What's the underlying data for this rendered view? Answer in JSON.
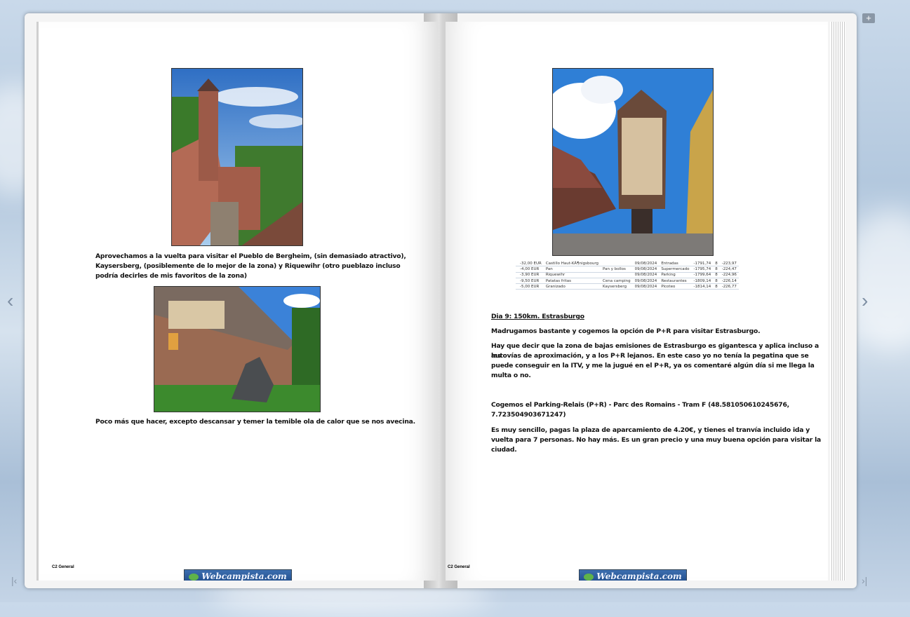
{
  "left_page": {
    "paragraph1": [
      "Aprovechamos a la vuelta para visitar el Pueblo de Bergheim, (sin demasiado atractivo),",
      "Kaysersberg,   (posiblemente de lo mejor de la zona)   y Riquewihr  (otro pueblazo incluso",
      "podría decirles de mis favoritos de la zona)"
    ],
    "paragraph2": "Poco más que hacer, excepto descansar y temer la temible ola de calor que se nos avecina.",
    "footer_label": "C2 General",
    "logo_text": "Webcampista.com"
  },
  "right_page": {
    "expenses": [
      [
        "-32,00 EUR",
        "Castillo Haut-KÃ¶nigsbourg",
        "",
        "09/08/2024",
        "Entradas",
        "-1791,74",
        "8",
        "-223,97"
      ],
      [
        "-4,00 EUR",
        "Pan",
        "Pan y bollos",
        "09/08/2024",
        "Supermercado",
        "-1795,74",
        "8",
        "-224,47"
      ],
      [
        "-3,90 EUR",
        "Riquewihr",
        "",
        "09/08/2024",
        "Parking",
        "-1799,64",
        "8",
        "-224,96"
      ],
      [
        "-9,50 EUR",
        "Patatas fritas",
        "Cena camping",
        "09/08/2024",
        "Restaurantes",
        "-1809,14",
        "8",
        "-226,14"
      ],
      [
        "-5,00 EUR",
        "Granizado",
        "Kaysersberg",
        "09/08/2024",
        "Picoteo",
        "-1814,14",
        "8",
        "-226,77"
      ]
    ],
    "heading": "Dia 9:  150km. Estrasburgo",
    "p1": "Madrugamos bastante y cogemos la opción de P+R para visitar Estrasburgo.",
    "p2": [
      "Hay que decir que la zona de bajas emisiones de Estrasburgo es gigantesca y aplica incluso a las",
      "autovías de aproximación, y a los P+R lejanos.  En este caso yo no tenía la pegatina que se",
      "puede conseguir en la ITV, y me la jugué en el P+R, ya os comentaré algún día si me llega la",
      "multa o no."
    ],
    "p3": [
      "Cogemos el  Parking-Relais (P+R) - Parc des Romains - Tram F  (48.581050610245676,",
      "7.723504903671247)"
    ],
    "p4": [
      "Es muy sencillo, pagas la plaza de aparcamiento de 4.20€, y tienes el tranvía incluido ida y",
      "vuelta para 7 personas. No hay más.  Es un gran precio y una muy buena opción para visitar la",
      "ciudad."
    ],
    "footer_label": "C2 General",
    "logo_text": "Webcampista.com"
  },
  "nav": {
    "prev": "‹",
    "next": "›",
    "first": "|‹",
    "last": "›|",
    "comment": "+"
  }
}
